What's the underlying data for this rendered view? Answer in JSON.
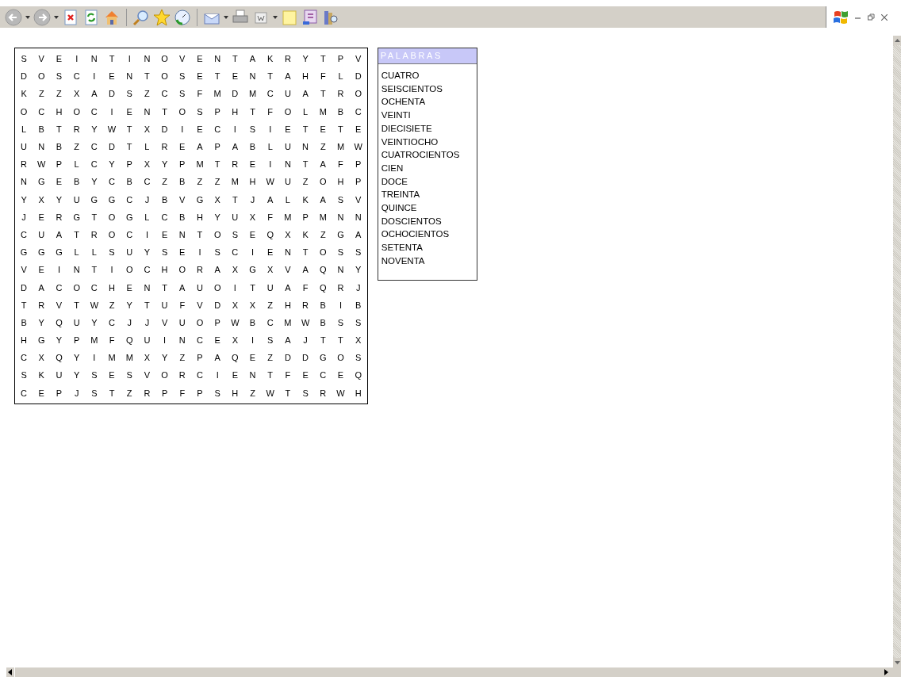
{
  "puzzle": {
    "rows": [
      [
        "S",
        "V",
        "E",
        "I",
        "N",
        "T",
        "I",
        "N",
        "O",
        "V",
        "E",
        "N",
        "T",
        "A",
        "K",
        "R",
        "Y",
        "T",
        "P",
        "V"
      ],
      [
        "D",
        "O",
        "S",
        "C",
        "I",
        "E",
        "N",
        "T",
        "O",
        "S",
        "E",
        "T",
        "E",
        "N",
        "T",
        "A",
        "H",
        "F",
        "L",
        "D"
      ],
      [
        "K",
        "Z",
        "Z",
        "X",
        "A",
        "D",
        "S",
        "Z",
        "C",
        "S",
        "F",
        "M",
        "D",
        "M",
        "C",
        "U",
        "A",
        "T",
        "R",
        "O"
      ],
      [
        "O",
        "C",
        "H",
        "O",
        "C",
        "I",
        "E",
        "N",
        "T",
        "O",
        "S",
        "P",
        "H",
        "T",
        "F",
        "O",
        "L",
        "M",
        "B",
        "C"
      ],
      [
        "L",
        "B",
        "T",
        "R",
        "Y",
        "W",
        "T",
        "X",
        "D",
        "I",
        "E",
        "C",
        "I",
        "S",
        "I",
        "E",
        "T",
        "E",
        "T",
        "E"
      ],
      [
        "U",
        "N",
        "B",
        "Z",
        "C",
        "D",
        "T",
        "L",
        "R",
        "E",
        "A",
        "P",
        "A",
        "B",
        "L",
        "U",
        "N",
        "Z",
        "M",
        "W"
      ],
      [
        "R",
        "W",
        "P",
        "L",
        "C",
        "Y",
        "P",
        "X",
        "Y",
        "P",
        "M",
        "T",
        "R",
        "E",
        "I",
        "N",
        "T",
        "A",
        "F",
        "P"
      ],
      [
        "N",
        "G",
        "E",
        "B",
        "Y",
        "C",
        "B",
        "C",
        "Z",
        "B",
        "Z",
        "Z",
        "M",
        "H",
        "W",
        "U",
        "Z",
        "O",
        "H",
        "P"
      ],
      [
        "Y",
        "X",
        "Y",
        "U",
        "G",
        "G",
        "C",
        "J",
        "B",
        "V",
        "G",
        "X",
        "T",
        "J",
        "A",
        "L",
        "K",
        "A",
        "S",
        "V"
      ],
      [
        "J",
        "E",
        "R",
        "G",
        "T",
        "O",
        "G",
        "L",
        "C",
        "B",
        "H",
        "Y",
        "U",
        "X",
        "F",
        "M",
        "P",
        "M",
        "N",
        "N"
      ],
      [
        "C",
        "U",
        "A",
        "T",
        "R",
        "O",
        "C",
        "I",
        "E",
        "N",
        "T",
        "O",
        "S",
        "E",
        "Q",
        "X",
        "K",
        "Z",
        "G",
        "A"
      ],
      [
        "G",
        "G",
        "G",
        "L",
        "L",
        "S",
        "U",
        "Y",
        "S",
        "E",
        "I",
        "S",
        "C",
        "I",
        "E",
        "N",
        "T",
        "O",
        "S",
        "S"
      ],
      [
        "V",
        "E",
        "I",
        "N",
        "T",
        "I",
        "O",
        "C",
        "H",
        "O",
        "R",
        "A",
        "X",
        "G",
        "X",
        "V",
        "A",
        "Q",
        "N",
        "Y"
      ],
      [
        "D",
        "A",
        "C",
        "O",
        "C",
        "H",
        "E",
        "N",
        "T",
        "A",
        "U",
        "O",
        "I",
        "T",
        "U",
        "A",
        "F",
        "Q",
        "R",
        "J"
      ],
      [
        "T",
        "R",
        "V",
        "T",
        "W",
        "Z",
        "Y",
        "T",
        "U",
        "F",
        "V",
        "D",
        "X",
        "X",
        "Z",
        "H",
        "R",
        "B",
        "I",
        "B"
      ],
      [
        "B",
        "Y",
        "Q",
        "U",
        "Y",
        "C",
        "J",
        "J",
        "V",
        "U",
        "O",
        "P",
        "W",
        "B",
        "C",
        "M",
        "W",
        "B",
        "S",
        "S"
      ],
      [
        "H",
        "G",
        "Y",
        "P",
        "M",
        "F",
        "Q",
        "U",
        "I",
        "N",
        "C",
        "E",
        "X",
        "I",
        "S",
        "A",
        "J",
        "T",
        "T",
        "X"
      ],
      [
        "C",
        "X",
        "Q",
        "Y",
        "I",
        "M",
        "M",
        "X",
        "Y",
        "Z",
        "P",
        "A",
        "Q",
        "E",
        "Z",
        "D",
        "D",
        "G",
        "O",
        "S"
      ],
      [
        "S",
        "K",
        "U",
        "Y",
        "S",
        "E",
        "S",
        "V",
        "O",
        "R",
        "C",
        "I",
        "E",
        "N",
        "T",
        "F",
        "E",
        "C",
        "E",
        "Q"
      ],
      [
        "C",
        "E",
        "P",
        "J",
        "S",
        "T",
        "Z",
        "R",
        "P",
        "F",
        "P",
        "S",
        "H",
        "Z",
        "W",
        "T",
        "S",
        "R",
        "W",
        "H"
      ]
    ]
  },
  "word_list": {
    "title": "PALABRAS",
    "words": [
      "CUATRO",
      "SEISCIENTOS",
      "OCHENTA",
      "VEINTI",
      "DIECISIETE",
      "VEINTIOCHO",
      "CUATROCIENTOS",
      "CIEN",
      "DOCE",
      "TREINTA",
      "QUINCE",
      "DOSCIENTOS",
      "OCHOCIENTOS",
      "SETENTA",
      "NOVENTA"
    ]
  }
}
